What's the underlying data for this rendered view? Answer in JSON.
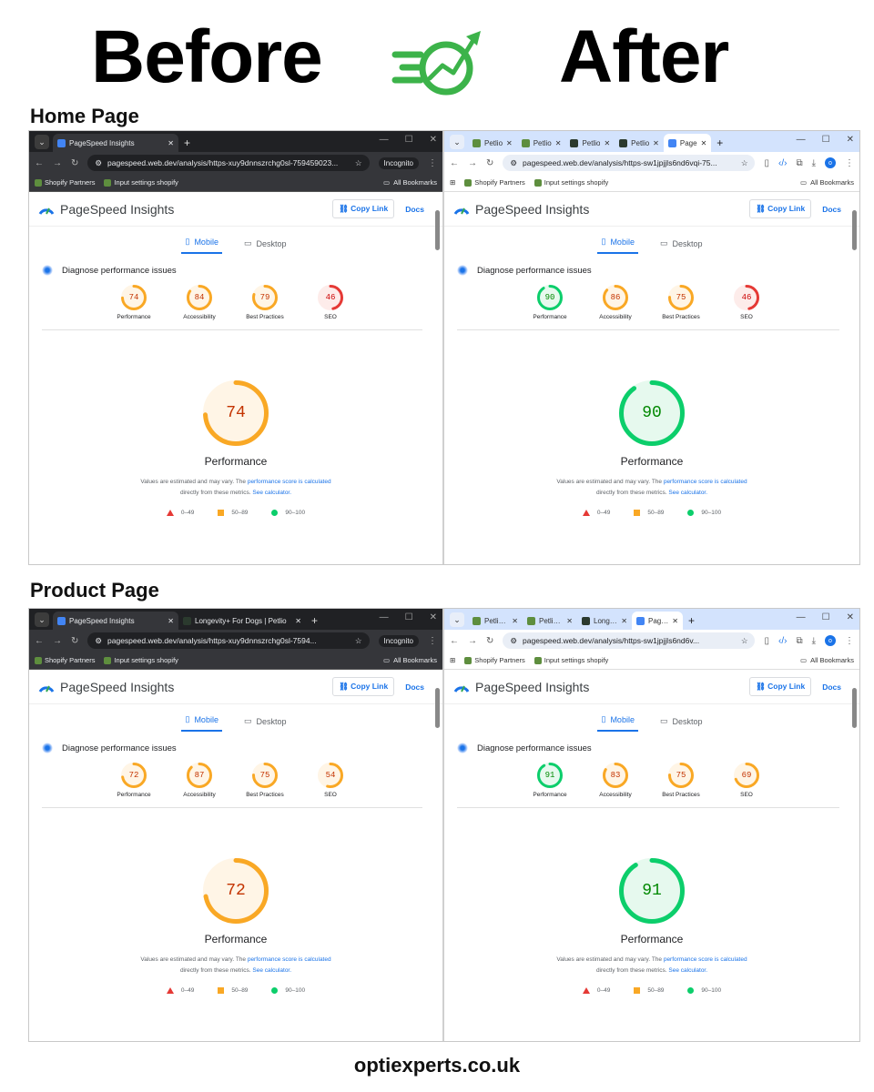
{
  "header": {
    "before": "Before",
    "after": "After",
    "logo_icon": "speed-growth-icon",
    "accent": "#3cb34a"
  },
  "sections": [
    {
      "title": "Home Page",
      "left": {
        "theme": "dark",
        "tabs": [
          {
            "label": "PageSpeed Insights",
            "active": true,
            "fav": "#4285f4"
          }
        ],
        "url": "pagespeed.web.dev/analysis/https-xuy9dnnszrchg0sl-759459023...",
        "incognito": "Incognito",
        "bookmarks": [
          "Shopify Partners",
          "Input settings shopify"
        ],
        "all_bookmarks": "All Bookmarks",
        "psi": {
          "title": "PageSpeed Insights",
          "copy_link": "Copy Link",
          "docs": "Docs",
          "mobile": "Mobile",
          "desktop": "Desktop",
          "diagnose": "Diagnose performance issues",
          "scores": [
            {
              "value": 74,
              "label": "Performance"
            },
            {
              "value": 84,
              "label": "Accessibility"
            },
            {
              "value": 79,
              "label": "Best Practices"
            },
            {
              "value": 46,
              "label": "SEO"
            }
          ],
          "main_score": 74,
          "main_label": "Performance"
        }
      },
      "right": {
        "theme": "light",
        "tabs": [
          {
            "label": "Petlio",
            "active": false,
            "fav": "#5e8e3e"
          },
          {
            "label": "Petlio",
            "active": false,
            "fav": "#5e8e3e"
          },
          {
            "label": "Petlio",
            "active": false,
            "fav": "#2b3a2e"
          },
          {
            "label": "Petlio",
            "active": false,
            "fav": "#2b3a2e"
          },
          {
            "label": "Page",
            "active": true,
            "fav": "#4285f4"
          }
        ],
        "url": "pagespeed.web.dev/analysis/https-sw1jpjjls6nd6vqi-75...",
        "bookmarks": [
          "Shopify Partners",
          "Input settings shopify"
        ],
        "all_bookmarks": "All Bookmarks",
        "profile": "o",
        "psi": {
          "title": "PageSpeed Insights",
          "copy_link": "Copy Link",
          "docs": "Docs",
          "mobile": "Mobile",
          "desktop": "Desktop",
          "diagnose": "Diagnose performance issues",
          "scores": [
            {
              "value": 90,
              "label": "Performance"
            },
            {
              "value": 86,
              "label": "Accessibility"
            },
            {
              "value": 75,
              "label": "Best Practices"
            },
            {
              "value": 46,
              "label": "SEO"
            }
          ],
          "main_score": 90,
          "main_label": "Performance"
        }
      }
    },
    {
      "title": "Product Page",
      "left": {
        "theme": "dark",
        "tabs": [
          {
            "label": "PageSpeed Insights",
            "active": true,
            "fav": "#4285f4"
          },
          {
            "label": "Longevity+ For Dogs | Petlio",
            "active": false,
            "fav": "#2b3a2e"
          }
        ],
        "url": "pagespeed.web.dev/analysis/https-xuy9dnnszrchg0sl-7594...",
        "incognito": "Incognito",
        "bookmarks": [
          "Shopify Partners",
          "Input settings shopify"
        ],
        "all_bookmarks": "All Bookmarks",
        "psi": {
          "title": "PageSpeed Insights",
          "copy_link": "Copy Link",
          "docs": "Docs",
          "mobile": "Mobile",
          "desktop": "Desktop",
          "diagnose": "Diagnose performance issues",
          "scores": [
            {
              "value": 72,
              "label": "Performance"
            },
            {
              "value": 87,
              "label": "Accessibility"
            },
            {
              "value": 75,
              "label": "Best Practices"
            },
            {
              "value": 54,
              "label": "SEO"
            }
          ],
          "main_score": 72,
          "main_label": "Performance"
        }
      },
      "right": {
        "theme": "light",
        "tabs": [
          {
            "label": "Petlio – Sh",
            "active": false,
            "fav": "#5e8e3e"
          },
          {
            "label": "Petlio – Th",
            "active": false,
            "fav": "#5e8e3e"
          },
          {
            "label": "Longevity",
            "active": false,
            "fav": "#2b3a2e"
          },
          {
            "label": "PageSpe",
            "active": true,
            "fav": "#4285f4"
          }
        ],
        "url": "pagespeed.web.dev/analysis/https-sw1jpjjls6nd6v...",
        "bookmarks": [
          "Shopify Partners",
          "Input settings shopify"
        ],
        "all_bookmarks": "All Bookmarks",
        "profile": "o",
        "psi": {
          "title": "PageSpeed Insights",
          "copy_link": "Copy Link",
          "docs": "Docs",
          "mobile": "Mobile",
          "desktop": "Desktop",
          "diagnose": "Diagnose performance issues",
          "scores": [
            {
              "value": 91,
              "label": "Performance"
            },
            {
              "value": 83,
              "label": "Accessibility"
            },
            {
              "value": 75,
              "label": "Best Practices"
            },
            {
              "value": 69,
              "label": "SEO"
            }
          ],
          "main_score": 91,
          "main_label": "Performance"
        }
      }
    }
  ],
  "note": {
    "text1": "Values are estimated and may vary. The ",
    "link1": "performance score is calculated",
    "text2": "directly from these metrics. ",
    "link2": "See calculator."
  },
  "legend": [
    {
      "range": "0–49",
      "color": "#e53935",
      "shape": "triangle"
    },
    {
      "range": "50–89",
      "color": "#f9a825",
      "shape": "square"
    },
    {
      "range": "90–100",
      "color": "#0cce6b",
      "shape": "circle"
    }
  ],
  "colors": {
    "red": "#e53935",
    "orange": "#f9a825",
    "green": "#0cce6b",
    "link": "#1a73e8"
  },
  "footer": "optiexperts.co.uk"
}
